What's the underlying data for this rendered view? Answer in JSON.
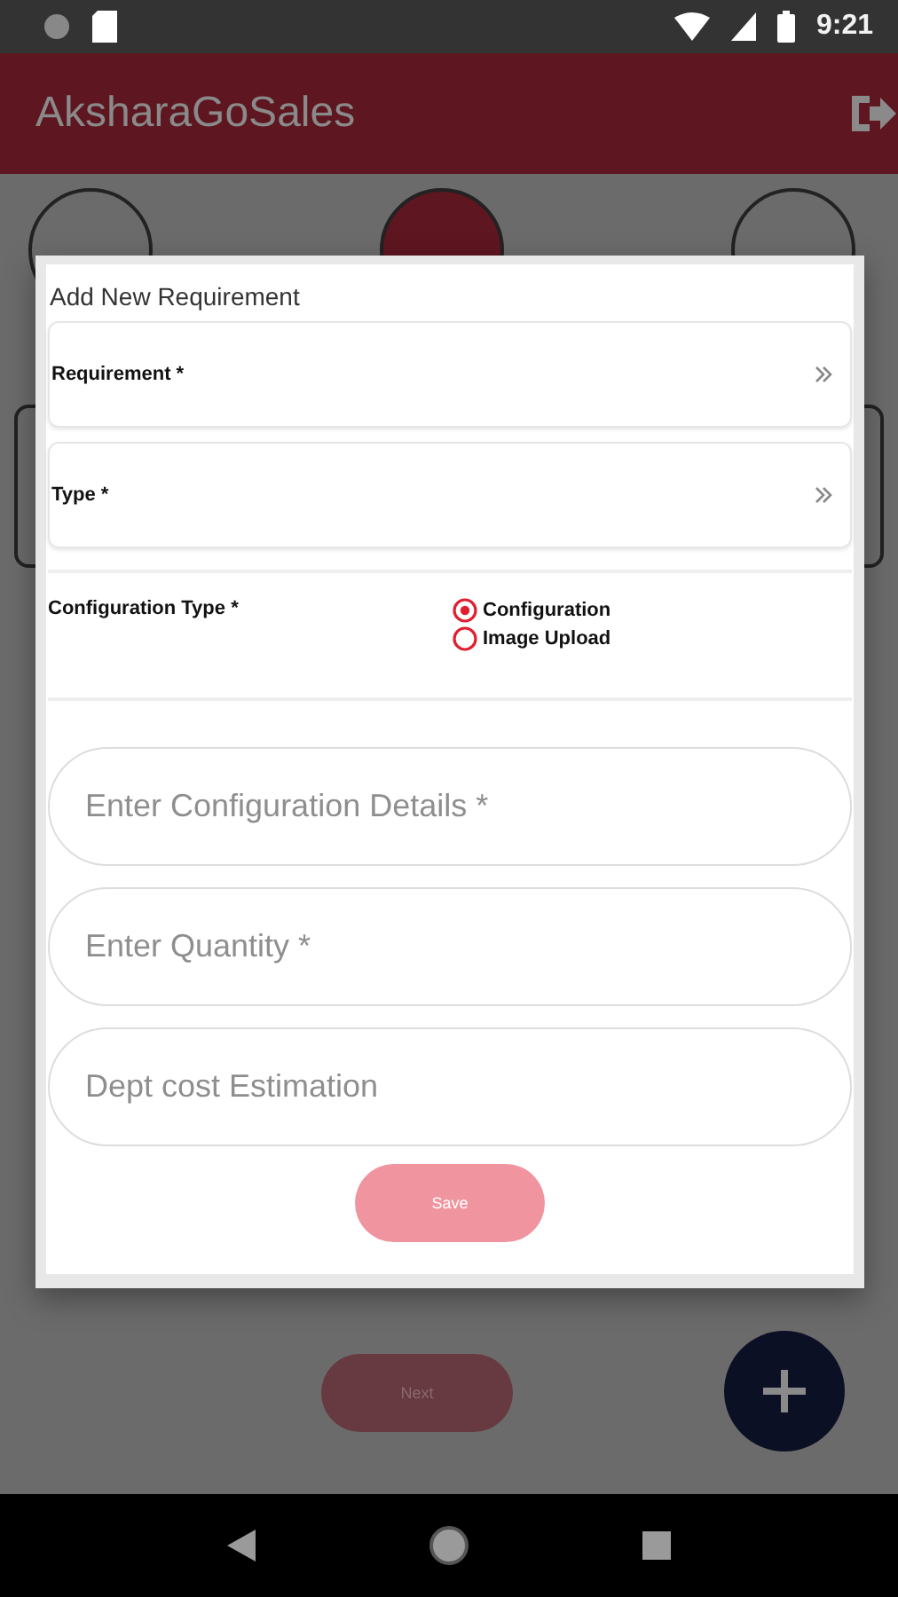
{
  "status_bar": {
    "time": "9:21"
  },
  "app_bar": {
    "title": "AksharaGoSales"
  },
  "steps": [
    {
      "selected": false
    },
    {
      "selected": true
    },
    {
      "selected": false
    }
  ],
  "dialog": {
    "title": "Add New Requirement",
    "pickers": [
      {
        "label": "Requirement *"
      },
      {
        "label": "Type *"
      }
    ],
    "configuration_type": {
      "label": "Configuration Type *",
      "options": [
        {
          "label": "Configuration",
          "selected": true
        },
        {
          "label": "Image Upload",
          "selected": false
        }
      ]
    },
    "fields": [
      {
        "placeholder": "Enter Configuration Details *"
      },
      {
        "placeholder": "Enter Quantity *"
      },
      {
        "placeholder": "Dept cost Estimation"
      }
    ],
    "save_button": "Save"
  },
  "next_button": "Next"
}
